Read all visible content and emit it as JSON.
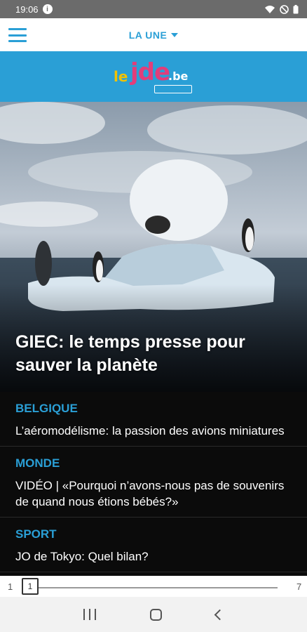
{
  "status_bar": {
    "time": "19:06",
    "info_icon": "i",
    "icons": [
      "wifi-icon",
      "dnd-icon",
      "battery-icon"
    ]
  },
  "topbar": {
    "section": "LA UNE"
  },
  "logo": {
    "le": "le",
    "jde": "jde",
    "be": ".be"
  },
  "hero": {
    "title": "GIEC: le temps presse pour sauver la planète"
  },
  "articles": [
    {
      "category": "BELGIQUE",
      "headline": "L’aéromodélisme: la passion des avions miniatures"
    },
    {
      "category": "MONDE",
      "headline": "VIDÉO | «Pourquoi n’avons-nous pas de souvenirs de quand nous étions bébés?»"
    },
    {
      "category": "SPORT",
      "headline": "JO de Tokyo: Quel bilan?"
    }
  ],
  "pager": {
    "min": "1",
    "max": "7",
    "current": "1",
    "progress": 0
  },
  "colors": {
    "accent": "#2a9fd6",
    "background": "#0b0b0b",
    "status_bar": "#6b6b6b"
  }
}
